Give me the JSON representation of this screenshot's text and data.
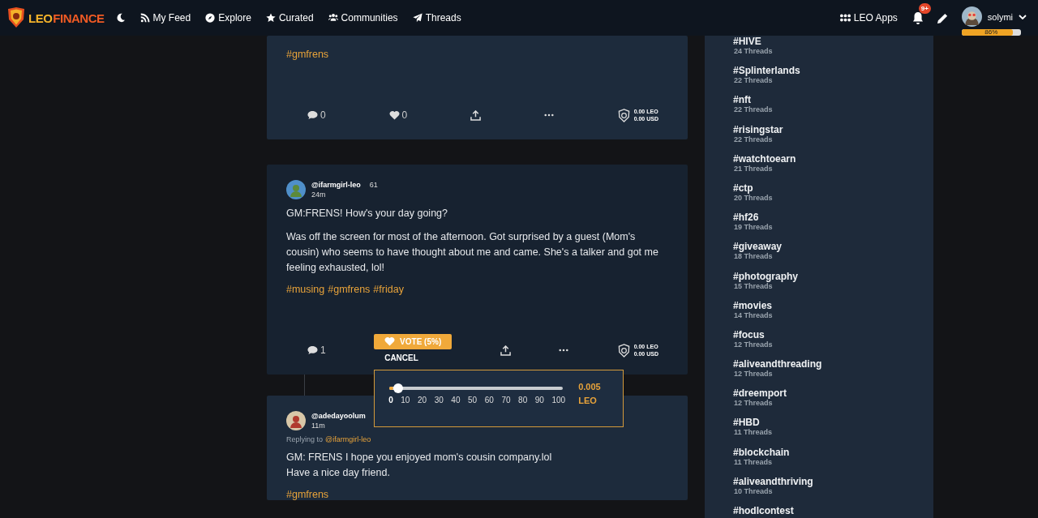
{
  "header": {
    "logo": {
      "part_1": "LEO",
      "part_2": "FINANCE"
    },
    "nav": [
      {
        "kind": "rss",
        "label": "My Feed"
      },
      {
        "kind": "compass",
        "label": "Explore"
      },
      {
        "kind": "star",
        "label": "Curated"
      },
      {
        "kind": "users",
        "label": "Communities"
      },
      {
        "kind": "plane",
        "label": "Threads"
      }
    ],
    "apps": "LEO Apps",
    "notification_badge": "9+",
    "user": {
      "name": "solymi",
      "progress": {
        "level": 0.86,
        "label": "86%"
      }
    }
  },
  "posts": [
    {
      "tags": [
        "#gmfrens"
      ],
      "comments": "0",
      "likes": "0",
      "payout": [
        "0.00 LEO",
        "0.00 USD"
      ]
    },
    {
      "author": "@ifarmgirl-leo",
      "reputation": "61",
      "time": "24m",
      "paragraphs": [
        "GM:FRENS! How's your day going?",
        "Was off the screen for most of the afternoon. Got surprised by a guest (Mom's cousin) who seems to have thought about me and came. She's a talker and got me feeling exhausted, lol!"
      ],
      "tags": [
        "#musing",
        "#gmfrens",
        "#friday"
      ],
      "comments": "1",
      "vote": {
        "button": "VOTE (5%)",
        "cancel": "CANCEL",
        "level": 0.05,
        "ticks": [
          "0",
          "10",
          "20",
          "30",
          "40",
          "50",
          "60",
          "70",
          "80",
          "90",
          "100"
        ],
        "amount": "0.005",
        "unit": "LEO"
      },
      "payout": [
        "0.00 LEO",
        "0.00 USD"
      ]
    },
    {
      "author": "@adedayoolum",
      "time": "11m",
      "reply_prefix": "Replying to",
      "reply_to": "@ifarmgirl-leo",
      "paragraphs": [
        "GM: FRENS I hope you enjoyed mom's cousin company.lol\nHave a nice day friend."
      ],
      "tags": [
        "#gmfrens"
      ]
    }
  ],
  "trending": [
    {
      "tag": "#HIVE",
      "count": "24 Threads"
    },
    {
      "tag": "#Splinterlands",
      "count": "22 Threads"
    },
    {
      "tag": "#nft",
      "count": "22 Threads"
    },
    {
      "tag": "#risingstar",
      "count": "22 Threads"
    },
    {
      "tag": "#watchtoearn",
      "count": "21 Threads"
    },
    {
      "tag": "#ctp",
      "count": "20 Threads"
    },
    {
      "tag": "#hf26",
      "count": "19 Threads"
    },
    {
      "tag": "#giveaway",
      "count": "18 Threads"
    },
    {
      "tag": "#photography",
      "count": "15 Threads"
    },
    {
      "tag": "#movies",
      "count": "14 Threads"
    },
    {
      "tag": "#focus",
      "count": "12 Threads"
    },
    {
      "tag": "#aliveandthreading",
      "count": "12 Threads"
    },
    {
      "tag": "#dreemport",
      "count": "12 Threads"
    },
    {
      "tag": "#HBD",
      "count": "11 Threads"
    },
    {
      "tag": "#blockchain",
      "count": "11 Threads"
    },
    {
      "tag": "#aliveandthriving",
      "count": "10 Threads"
    },
    {
      "tag": "#hodlcontest"
    }
  ]
}
